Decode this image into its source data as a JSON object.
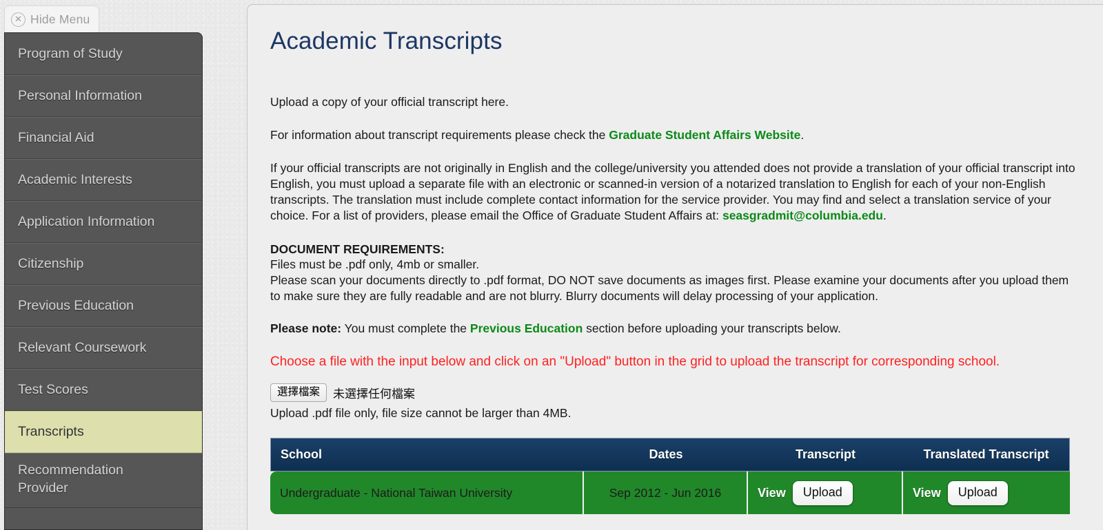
{
  "hide_menu": {
    "label": "Hide Menu",
    "icon": "close-circle-icon",
    "icon_glyph": "✕"
  },
  "sidebar": {
    "items": [
      {
        "label": "Program of Study",
        "active": false
      },
      {
        "label": "Personal Information",
        "active": false
      },
      {
        "label": "Financial Aid",
        "active": false
      },
      {
        "label": "Academic Interests",
        "active": false
      },
      {
        "label": "Application Information",
        "active": false
      },
      {
        "label": "Citizenship",
        "active": false
      },
      {
        "label": "Previous Education",
        "active": false
      },
      {
        "label": "Relevant Coursework",
        "active": false
      },
      {
        "label": "Test Scores",
        "active": false
      },
      {
        "label": "Transcripts",
        "active": true
      },
      {
        "label": "Recommendation Provider",
        "active": false,
        "line1": "Recommendation",
        "line2": "Provider"
      }
    ]
  },
  "main": {
    "title": "Academic Transcripts",
    "p_upload": "Upload a copy of your official transcript here.",
    "p_reqinfo_before": "For information about transcript requirements please check the ",
    "p_reqinfo_link": "Graduate Student Affairs Website",
    "p_reqinfo_after": ".",
    "p_translation": "If your official transcripts are not originally in English and the college/university you attended does not provide a translation of your official transcript into English, you must upload a separate file with an electronic or scanned-in version of a notarized translation to English for each of your non-English transcripts. The translation must include complete contact information for the service provider. You may find and select a translation service of your choice. For a list of providers, please email the Office of Graduate Student Affairs at:",
    "email": "seasgradmit@columbia.edu",
    "email_after": ".",
    "doc_requirements_heading": "DOCUMENT REQUIREMENTS:",
    "doc_req_line1": "Files must be .pdf only, 4mb or smaller.",
    "doc_req_line2": "Please scan your documents directly to .pdf format, DO NOT save documents as images first. Please examine your documents after you upload them to make sure they are fully readable and are not blurry. Blurry documents will delay processing of your application.",
    "note_label": "Please note:",
    "note_before": " You must complete the ",
    "note_link": "Previous Education",
    "note_after": " section before uploading your transcripts below.",
    "red_warning": "Choose a file with the input below and click on an \"Upload\" button in the grid to upload the transcript for corresponding school.",
    "file_button_label": "選擇檔案",
    "file_status_text": "未選擇任何檔案",
    "size_note": "Upload .pdf file only, file size cannot be larger than 4MB."
  },
  "table": {
    "columns": [
      "School",
      "Dates",
      "Transcript",
      "Translated Transcript"
    ],
    "rows": [
      {
        "school": "Undergraduate - National Taiwan University",
        "dates": "Sep 2012 - Jun 2016",
        "transcript_view": "View",
        "transcript_upload": "Upload",
        "translated_view": "View",
        "translated_upload": "Upload"
      }
    ]
  },
  "colors": {
    "accent_navy": "#1d3663",
    "header_navy": "#0d2f51",
    "row_green": "#21882a",
    "link_green": "#0b8a18",
    "warning_red": "#ff2020",
    "sidebar_gray": "#565656",
    "sidebar_active": "#dde0ad"
  }
}
